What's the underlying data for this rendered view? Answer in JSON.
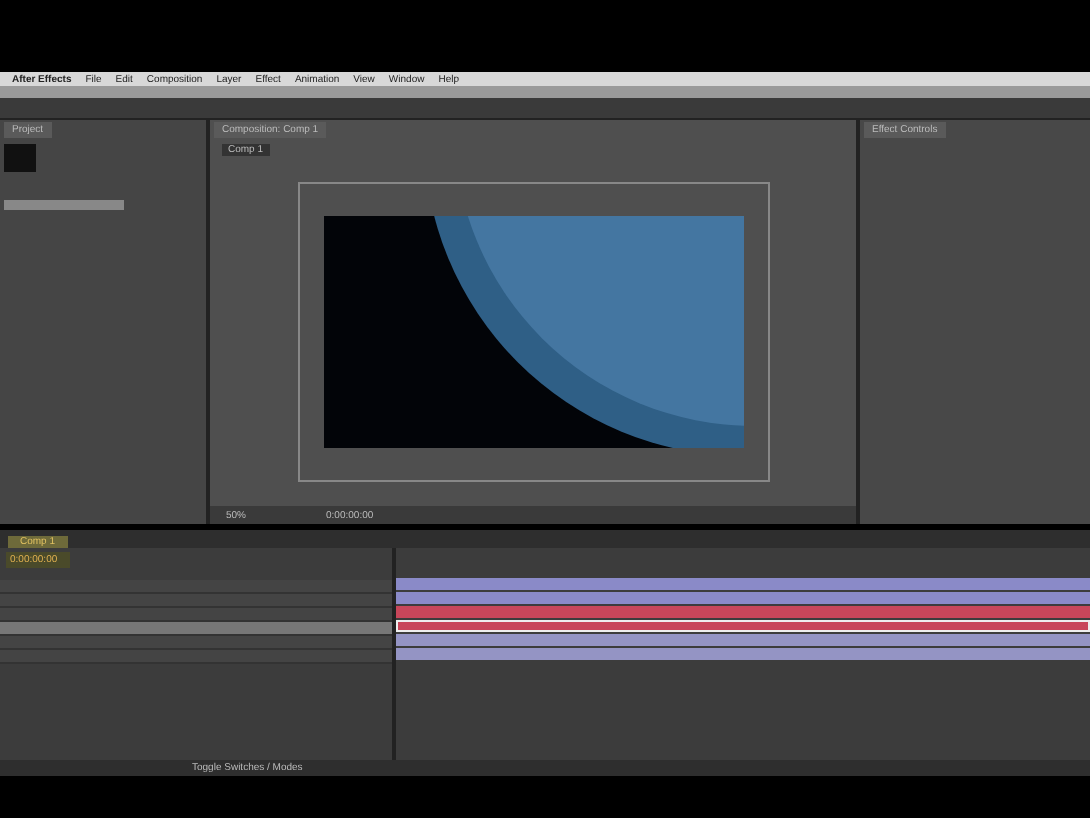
{
  "menu": [
    {
      "label": "After Effects"
    },
    {
      "label": "File"
    },
    {
      "label": "Edit"
    },
    {
      "label": "Composition"
    },
    {
      "label": "Layer"
    },
    {
      "label": "Effect"
    },
    {
      "label": "Animation"
    },
    {
      "label": "View"
    },
    {
      "label": "Window"
    },
    {
      "label": "Help"
    }
  ],
  "project": {
    "title": "Project"
  },
  "composition": {
    "tab": "Composition: Comp 1",
    "subtab": "Comp 1",
    "zoom": "50%",
    "timecode": "0:00:00:00"
  },
  "effects": {
    "tab": "Effect Controls"
  },
  "timeline": {
    "tab": "Comp 1",
    "timecode": "0:00:00:00",
    "footer": "Toggle Switches / Modes",
    "layers": [
      {
        "color": "#8a8ac8",
        "selected": false
      },
      {
        "color": "#8a8ac8",
        "selected": false
      },
      {
        "color": "#c8465a",
        "selected": false
      },
      {
        "color": "#c8465a",
        "selected": true
      },
      {
        "color": "#9494c4",
        "selected": false
      },
      {
        "color": "#9494c4",
        "selected": false
      }
    ]
  }
}
